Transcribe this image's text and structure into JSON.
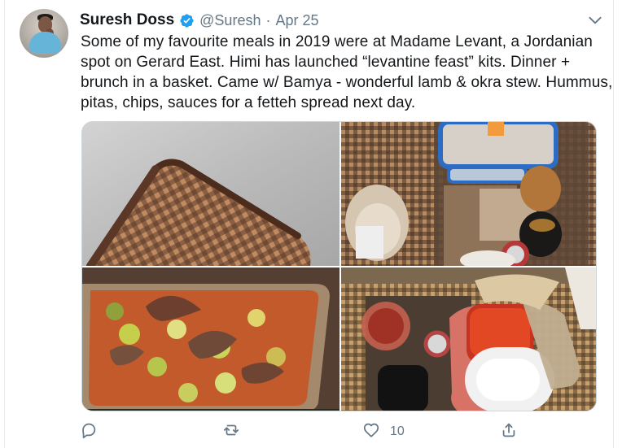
{
  "tweet": {
    "author": {
      "name": "Suresh Doss",
      "handle": "@Suresh",
      "separator": "·",
      "date": "Apr 25"
    },
    "text_lines": [
      "Some of my favourite meals in 2019 were at Madame Levant, a Jordanian",
      "spot on Gerard East. Himi has launched  “levantine feast” kits. Dinner +",
      "brunch in a basket. Came w/ Bamya - wonderful lamb & okra stew. Hummus,",
      "pitas, chips, sauces for a fetteh spread next day."
    ],
    "media": {
      "photo_1": "basket-on-table",
      "photo_2": "basket-contents",
      "photo_3": "okra-stew-container",
      "photo_4": "jar-and-basket"
    },
    "actions": {
      "reply_icon": "reply-icon",
      "retweet_icon": "retweet-icon",
      "like_icon": "heart-icon",
      "like_count": "10",
      "share_icon": "share-icon"
    }
  },
  "colors": {
    "text": "#14171a",
    "muted": "#657786",
    "verified": "#1da1f2",
    "border": "#ccd6dd"
  }
}
